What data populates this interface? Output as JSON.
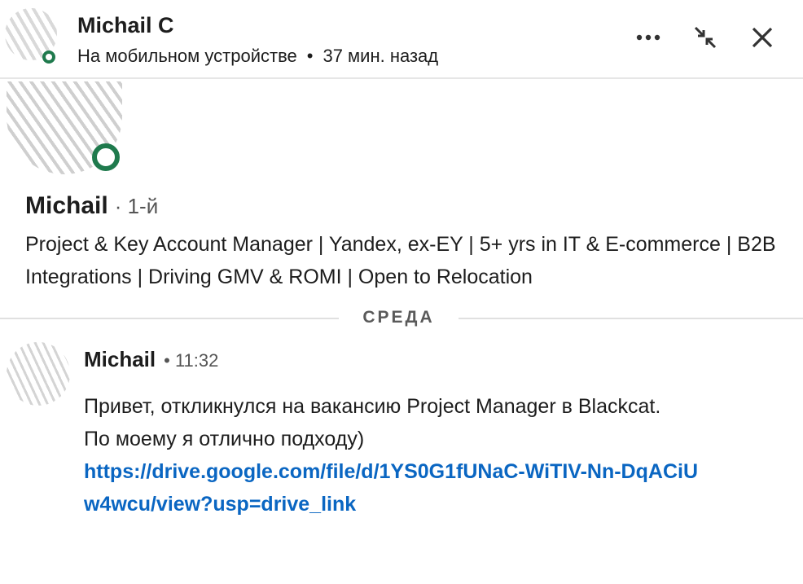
{
  "header": {
    "name": "Michail С",
    "status_text": "На мобильном устройстве",
    "separator": "•",
    "last_seen": "37 мин. назад"
  },
  "profile": {
    "name": "Michail",
    "degree": "· 1-й",
    "headline": "Project & Key Account Manager | Yandex, ex-EY | 5+ yrs in IT & E-commerce | B2B Integrations | Driving GMV & ROMI | Open to Relocation"
  },
  "divider": {
    "label": "СРЕДА"
  },
  "message": {
    "author": "Michail",
    "time": "• 11:32",
    "lines": [
      "Привет, откликнулся на вакансию Project Manager в Blackcat.",
      "По моему я отлично подходу)"
    ],
    "link": "https://drive.google.com/file/d/1YS0G1fUNaC-WiTIV-Nn-DqACiUw4wcu/view?usp=drive_link"
  },
  "icons": {
    "more": "more-horizontal-icon",
    "minimize": "collapse-arrows-icon",
    "close": "close-icon"
  },
  "colors": {
    "online": "#1f7a4d",
    "link": "#0a66c2"
  }
}
